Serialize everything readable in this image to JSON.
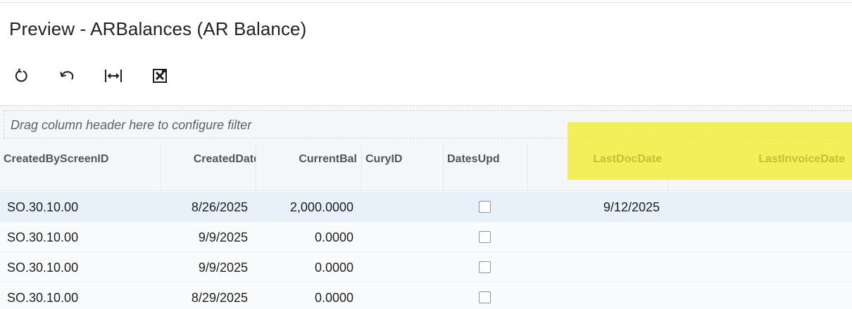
{
  "page": {
    "title": "Preview - ARBalances (AR Balance)"
  },
  "toolbar": {
    "buttons": [
      {
        "name": "refresh",
        "icon": "refresh-icon"
      },
      {
        "name": "undo",
        "icon": "undo-icon"
      },
      {
        "name": "fit-columns",
        "icon": "fit-columns-icon"
      },
      {
        "name": "export-excel",
        "icon": "excel-icon"
      }
    ]
  },
  "filter": {
    "placeholder": "Drag column header here to configure filter"
  },
  "grid": {
    "columns": [
      {
        "label": "CreatedByScreenID",
        "align": "left"
      },
      {
        "label": "CreatedDate",
        "align": "right"
      },
      {
        "label": "CurrentBal",
        "align": "right"
      },
      {
        "label": "CuryID",
        "align": "left"
      },
      {
        "label": "DatesUpd",
        "align": "left"
      },
      {
        "label": "LastDocDate",
        "align": "right"
      },
      {
        "label": "LastInvoiceDate",
        "align": "right"
      }
    ],
    "rows": [
      {
        "screen_id": "SO.30.10.00",
        "created_date": "8/26/2025",
        "current_bal": "2,000.0000",
        "cury_id": "",
        "dates_upd": false,
        "last_doc_date": "9/12/2025",
        "last_invoice_date": "",
        "selected": true
      },
      {
        "screen_id": "SO.30.10.00",
        "created_date": "9/9/2025",
        "current_bal": "0.0000",
        "cury_id": "",
        "dates_upd": false,
        "last_doc_date": "",
        "last_invoice_date": "",
        "selected": false
      },
      {
        "screen_id": "SO.30.10.00",
        "created_date": "9/9/2025",
        "current_bal": "0.0000",
        "cury_id": "",
        "dates_upd": false,
        "last_doc_date": "",
        "last_invoice_date": "",
        "selected": false
      },
      {
        "screen_id": "SO.30.10.00",
        "created_date": "8/29/2025",
        "current_bal": "0.0000",
        "cury_id": "",
        "dates_upd": false,
        "last_doc_date": "",
        "last_invoice_date": "",
        "selected": false
      }
    ]
  },
  "colors": {
    "highlight": "#f0ec1e",
    "selected_row": "#e6f1fa",
    "header_bg": "#f6f7f8"
  }
}
